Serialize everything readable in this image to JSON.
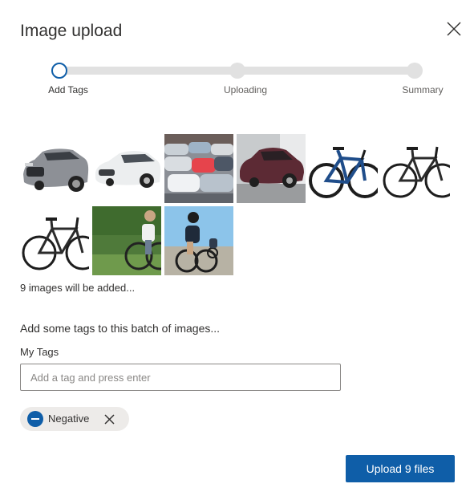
{
  "dialog": {
    "title": "Image upload",
    "close_icon": "close-icon"
  },
  "stepper": {
    "steps": [
      {
        "label": "Add Tags",
        "active": true
      },
      {
        "label": "Uploading",
        "active": false
      },
      {
        "label": "Summary",
        "active": false
      }
    ],
    "accent": "#0f5ea8"
  },
  "images": {
    "thumbnails": [
      {
        "name": "thumbnail-silver-suv"
      },
      {
        "name": "thumbnail-white-sedan"
      },
      {
        "name": "thumbnail-parking-lot"
      },
      {
        "name": "thumbnail-maroon-sedan"
      },
      {
        "name": "thumbnail-blue-bicycle"
      },
      {
        "name": "thumbnail-black-bicycle"
      },
      {
        "name": "thumbnail-black-fixed-bicycle"
      },
      {
        "name": "thumbnail-cyclist-grass"
      },
      {
        "name": "thumbnail-cyclists-road"
      }
    ],
    "count_note": "9 images will be added..."
  },
  "tags": {
    "heading": "Add some tags to this batch of images...",
    "label": "My Tags",
    "input_value": "",
    "input_placeholder": "Add a tag and press enter",
    "chips": [
      {
        "label": "Negative",
        "icon": "minus-circle-icon",
        "remove_icon": "close-icon"
      }
    ]
  },
  "footer": {
    "upload_label": "Upload 9 files",
    "button_color": "#0f5ea8"
  }
}
